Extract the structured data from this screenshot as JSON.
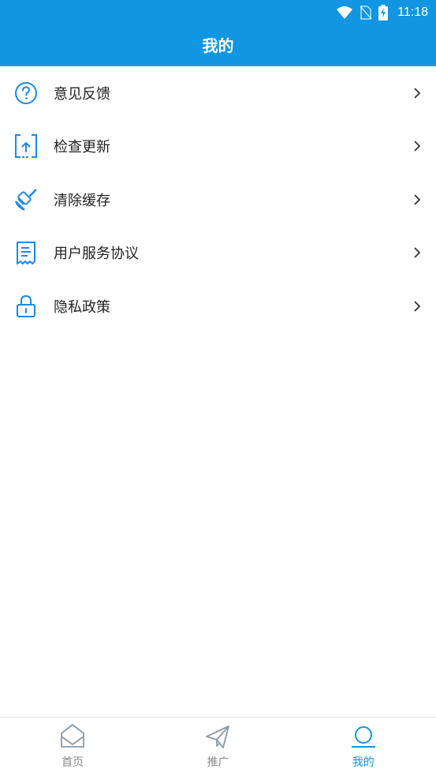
{
  "status": {
    "time": "11:18"
  },
  "header": {
    "title": "我的"
  },
  "menu": [
    {
      "label": "意见反馈"
    },
    {
      "label": "检查更新"
    },
    {
      "label": "清除缓存"
    },
    {
      "label": "用户服务协议"
    },
    {
      "label": "隐私政策"
    }
  ],
  "tabs": [
    {
      "label": "首页"
    },
    {
      "label": "推广"
    },
    {
      "label": "我的"
    }
  ],
  "colors": {
    "primary": "#1296e1"
  }
}
